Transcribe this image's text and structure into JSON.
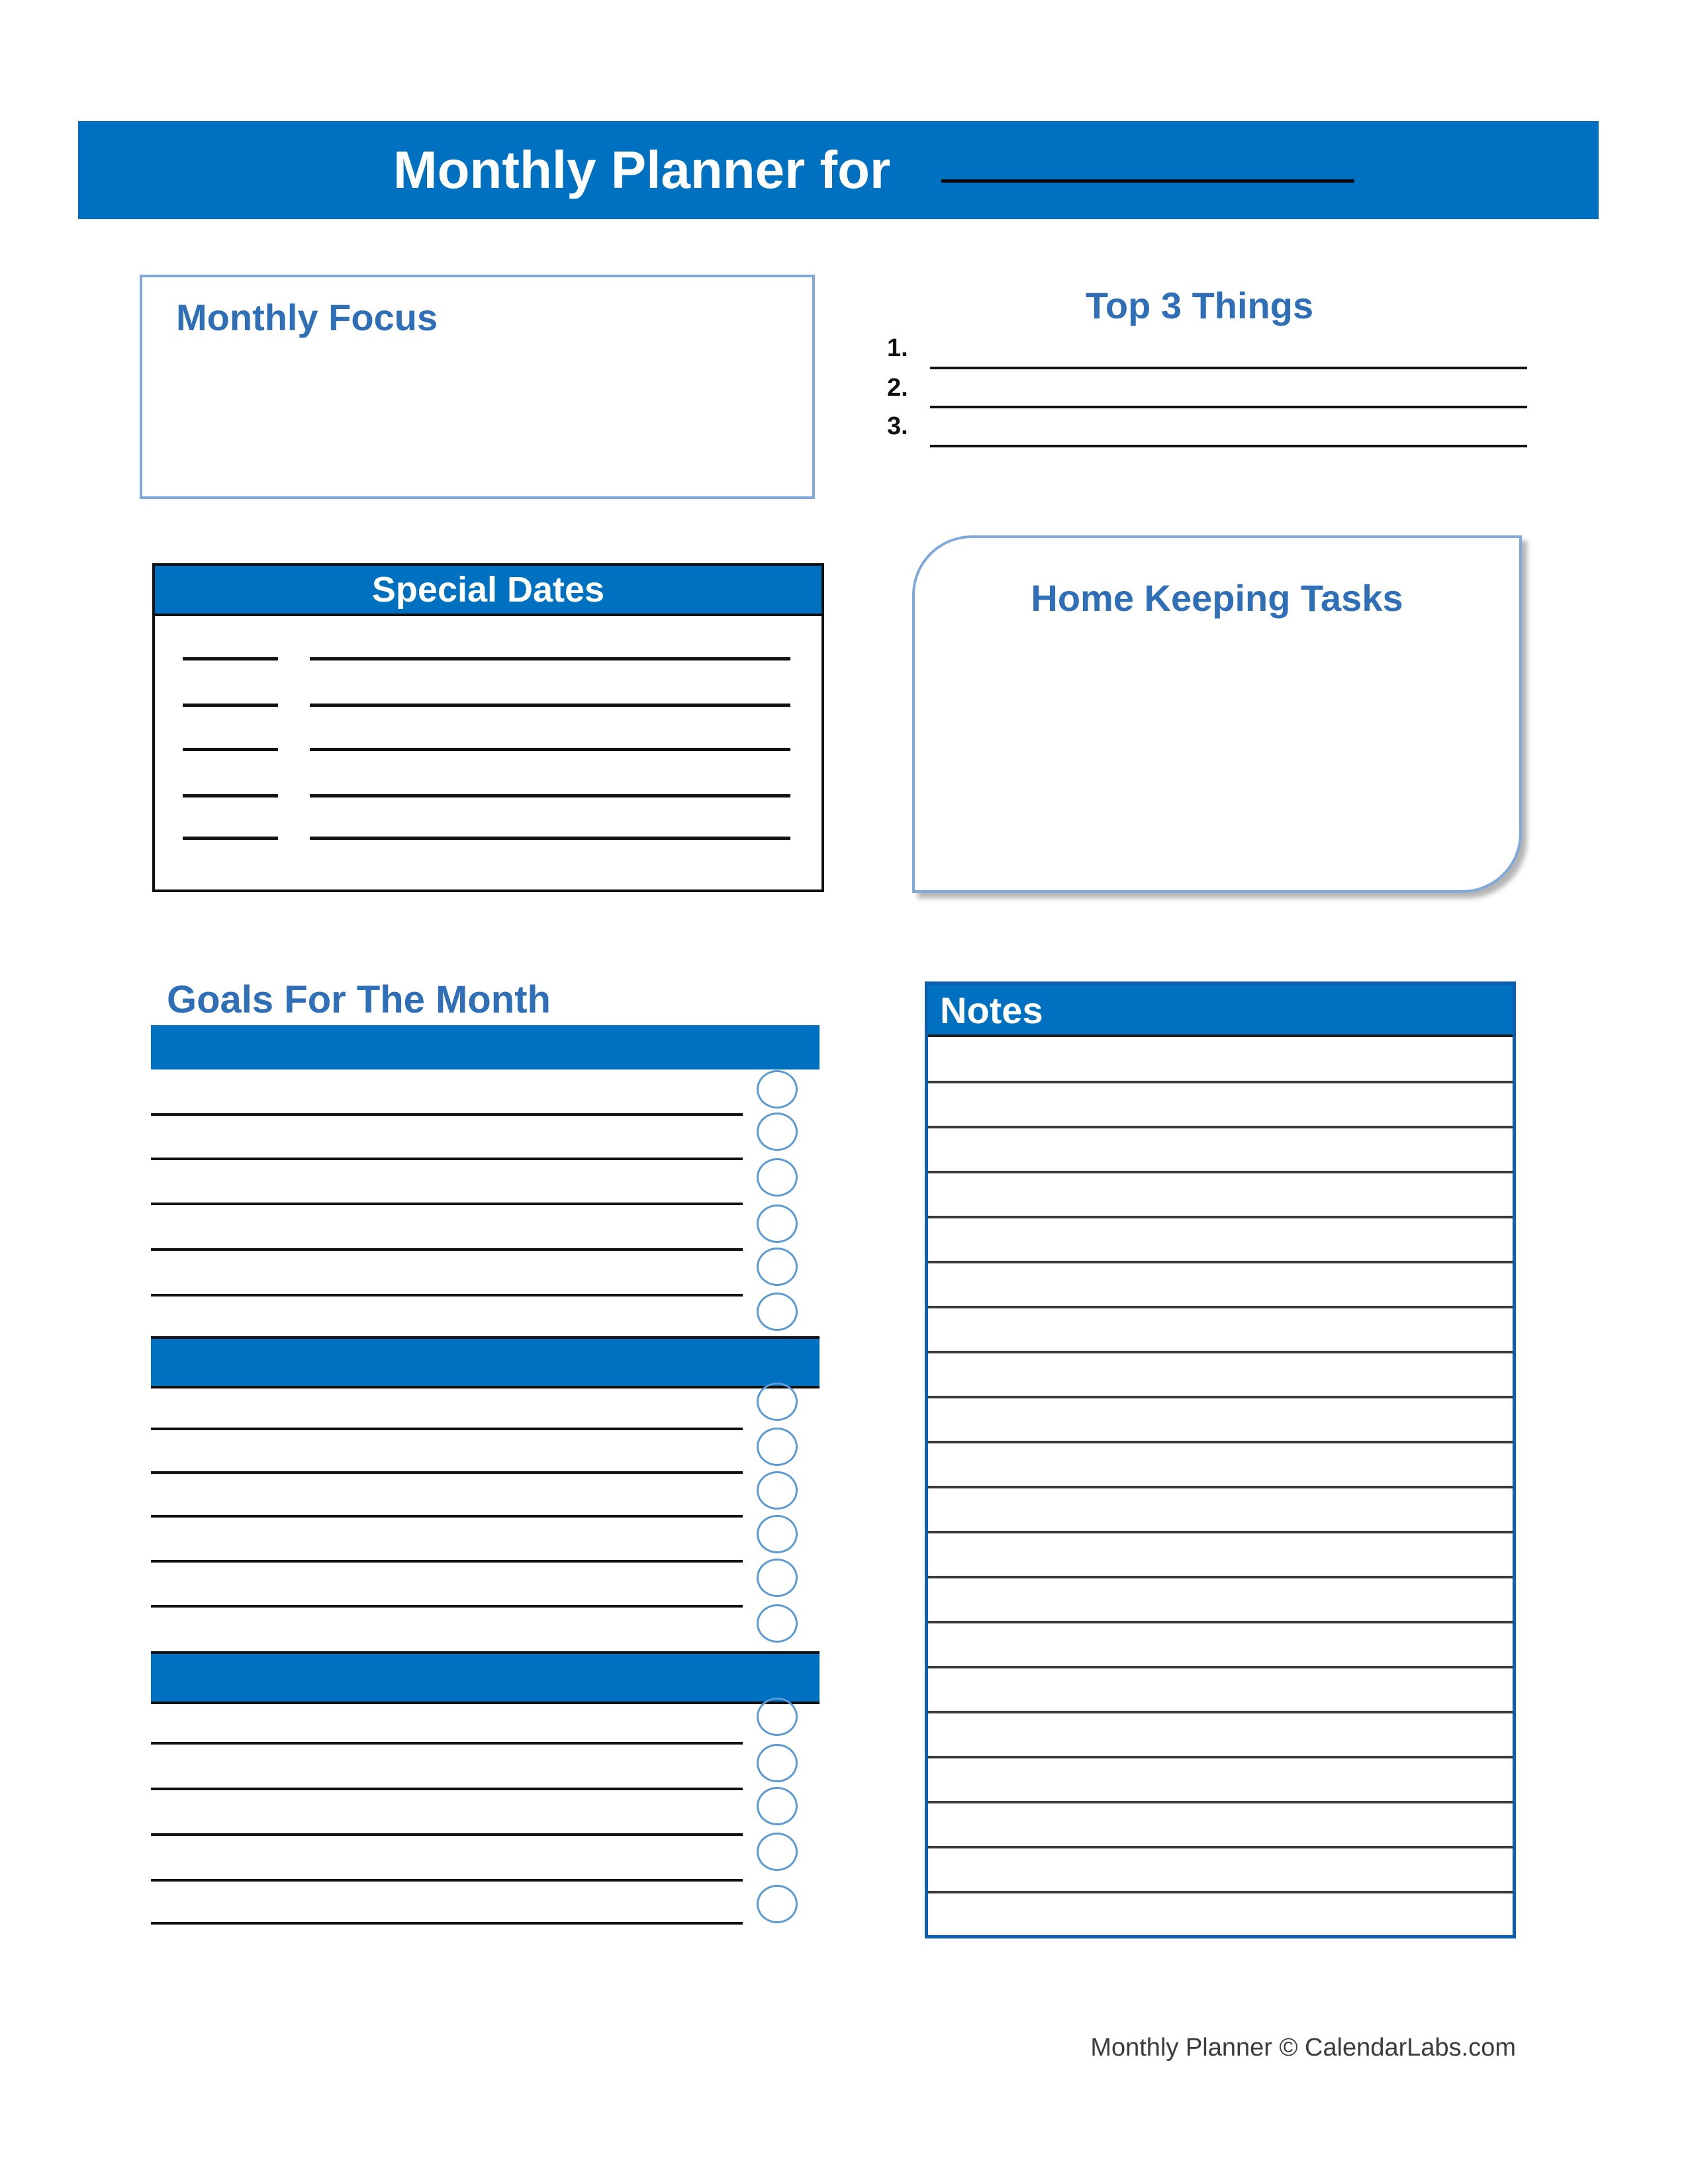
{
  "header": {
    "title": "Monthly Planner for",
    "month_blank": ""
  },
  "monthly_focus": {
    "title": "Monthly Focus",
    "content": ""
  },
  "top_three": {
    "title": "Top 3 Things",
    "items": [
      {
        "number": "1.",
        "value": ""
      },
      {
        "number": "2.",
        "value": ""
      },
      {
        "number": "3.",
        "value": ""
      }
    ]
  },
  "special_dates": {
    "title": "Special Dates",
    "rows": [
      {
        "date": "",
        "event": ""
      },
      {
        "date": "",
        "event": ""
      },
      {
        "date": "",
        "event": ""
      },
      {
        "date": "",
        "event": ""
      },
      {
        "date": "",
        "event": ""
      }
    ]
  },
  "home_keeping": {
    "title": "Home Keeping Tasks",
    "content": ""
  },
  "goals": {
    "title": "Goals For The Month",
    "groups": [
      {
        "heading": "",
        "items": [
          {
            "text": "",
            "done": false
          },
          {
            "text": "",
            "done": false
          },
          {
            "text": "",
            "done": false
          },
          {
            "text": "",
            "done": false
          },
          {
            "text": "",
            "done": false
          },
          {
            "text": "",
            "done": false
          }
        ]
      },
      {
        "heading": "",
        "items": [
          {
            "text": "",
            "done": false
          },
          {
            "text": "",
            "done": false
          },
          {
            "text": "",
            "done": false
          },
          {
            "text": "",
            "done": false
          },
          {
            "text": "",
            "done": false
          },
          {
            "text": "",
            "done": false
          }
        ]
      },
      {
        "heading": "",
        "items": [
          {
            "text": "",
            "done": false
          },
          {
            "text": "",
            "done": false
          },
          {
            "text": "",
            "done": false
          },
          {
            "text": "",
            "done": false
          },
          {
            "text": "",
            "done": false
          }
        ]
      }
    ]
  },
  "notes": {
    "title": "Notes",
    "line_count": 20
  },
  "footer": {
    "text": "Monthly Planner © CalendarLabs.com"
  },
  "colors": {
    "brand_blue": "#0070C0",
    "heading_blue": "#2E6FB8",
    "outline_blue": "#7FA8DC",
    "checkbox_blue": "#5B9BD5"
  }
}
